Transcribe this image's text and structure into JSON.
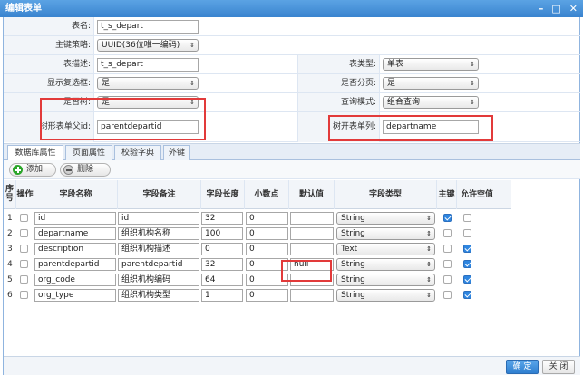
{
  "window": {
    "title": "编辑表单",
    "min_icon": "minimize-icon",
    "max_icon": "maximize-icon",
    "close_icon": "close-icon"
  },
  "form": {
    "table_name": {
      "label": "表名:",
      "value": "t_s_depart"
    },
    "pk_strategy": {
      "label": "主键策略:",
      "value": "UUID(36位唯一编码)"
    },
    "table_desc": {
      "label": "表描述:",
      "value": "t_s_depart"
    },
    "table_type": {
      "label": "表类型:",
      "value": "单表"
    },
    "show_checkbox": {
      "label": "显示复选框:",
      "value": "是"
    },
    "is_paged": {
      "label": "是否分页:",
      "value": "是"
    },
    "is_tree": {
      "label": "是否树:",
      "value": "是"
    },
    "query_mode": {
      "label": "查询模式:",
      "value": "组合查询"
    },
    "tree_parent_id": {
      "label": "树形表单父id:",
      "value": "parentdepartid"
    },
    "tree_expand_col": {
      "label": "树开表单列:",
      "value": "departname"
    }
  },
  "tabs": [
    "数据库属性",
    "页面属性",
    "校验字典",
    "外键"
  ],
  "toolbar": {
    "add_label": "添加",
    "delete_label": "删除"
  },
  "grid": {
    "headers": {
      "seq": "序号",
      "op": "操作",
      "field_name": "字段名称",
      "field_remark": "字段备注",
      "length": "字段长度",
      "decimal": "小数点",
      "default": "默认值",
      "type": "字段类型",
      "pk": "主键",
      "nullable": "允许空值"
    },
    "rows": [
      {
        "seq": "1",
        "name": "id",
        "remark": "id",
        "length": "32",
        "decimal": "0",
        "default": "",
        "type": "String",
        "pk": true,
        "nullable": false
      },
      {
        "seq": "2",
        "name": "departname",
        "remark": "组织机构名称",
        "length": "100",
        "decimal": "0",
        "default": "",
        "type": "String",
        "pk": false,
        "nullable": false
      },
      {
        "seq": "3",
        "name": "description",
        "remark": "组织机构描述",
        "length": "0",
        "decimal": "0",
        "default": "",
        "type": "Text",
        "pk": false,
        "nullable": true
      },
      {
        "seq": "4",
        "name": "parentdepartid",
        "remark": "parentdepartid",
        "length": "32",
        "decimal": "0",
        "default": "null",
        "type": "String",
        "pk": false,
        "nullable": true
      },
      {
        "seq": "5",
        "name": "org_code",
        "remark": "组织机构编码",
        "length": "64",
        "decimal": "0",
        "default": "",
        "type": "String",
        "pk": false,
        "nullable": true
      },
      {
        "seq": "6",
        "name": "org_type",
        "remark": "组织机构类型",
        "length": "1",
        "decimal": "0",
        "default": "",
        "type": "String",
        "pk": false,
        "nullable": true
      }
    ]
  },
  "footer": {
    "ok_label": "确 定",
    "close_label": "关 闭"
  },
  "colors": {
    "accent": "#3a84cf",
    "highlight": "#e23a3a",
    "checkbox_on": "#2f86e0"
  }
}
